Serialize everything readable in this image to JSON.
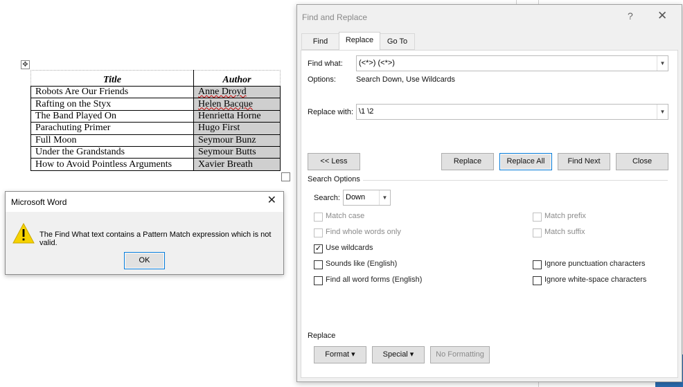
{
  "document": {
    "table": {
      "headers": [
        "Title",
        "Author"
      ],
      "rows": [
        {
          "title": "Robots Are Our Friends",
          "author": "Anne Droyd"
        },
        {
          "title": "Rafting on the Styx",
          "author": "Helen Bacque"
        },
        {
          "title": "The Band Played On",
          "author": "Henrietta Horne"
        },
        {
          "title": "Parachuting Primer",
          "author": "Hugo First"
        },
        {
          "title": "Full Moon",
          "author": "Seymour Bunz"
        },
        {
          "title": "Under the Grandstands",
          "author": "Seymour Butts"
        },
        {
          "title": "How to Avoid Pointless Arguments",
          "author": "Xavier Breath"
        }
      ]
    }
  },
  "error_dialog": {
    "title": "Microsoft Word",
    "message": "The Find What text contains a Pattern Match expression which is not valid.",
    "ok_label": "OK"
  },
  "find_replace": {
    "title": "Find and Replace",
    "help_glyph": "?",
    "close_glyph": "✕",
    "tabs": [
      "Find",
      "Replace",
      "Go To"
    ],
    "active_tab": "Replace",
    "find_what_label": "Find what:",
    "find_what_value": "(<*>) (<*>)",
    "options_label": "Options:",
    "options_value": "Search Down, Use Wildcards",
    "replace_with_label": "Replace with:",
    "replace_with_value": "\\1 \\2",
    "buttons": {
      "less": "<< Less",
      "replace": "Replace",
      "replace_all": "Replace All",
      "find_next": "Find Next",
      "close": "Close"
    },
    "search_options_heading": "Search Options",
    "search_label": "Search:",
    "search_value": "Down",
    "checkboxes_left": [
      {
        "label": "Match case",
        "checked": false,
        "enabled": false
      },
      {
        "label": "Find whole words only",
        "checked": false,
        "enabled": false
      },
      {
        "label": "Use wildcards",
        "checked": true,
        "enabled": true
      },
      {
        "label": "Sounds like (English)",
        "checked": false,
        "enabled": true
      },
      {
        "label": "Find all word forms (English)",
        "checked": false,
        "enabled": true
      }
    ],
    "checkboxes_right": [
      {
        "label": "Match prefix",
        "checked": false,
        "enabled": false
      },
      {
        "label": "Match suffix",
        "checked": false,
        "enabled": false
      },
      {
        "label": "Ignore punctuation characters",
        "checked": false,
        "enabled": true
      },
      {
        "label": "Ignore white-space characters",
        "checked": false,
        "enabled": true
      }
    ],
    "replace_heading": "Replace",
    "format_label": "Format ▾",
    "special_label": "Special ▾",
    "no_formatting_label": "No Formatting"
  }
}
